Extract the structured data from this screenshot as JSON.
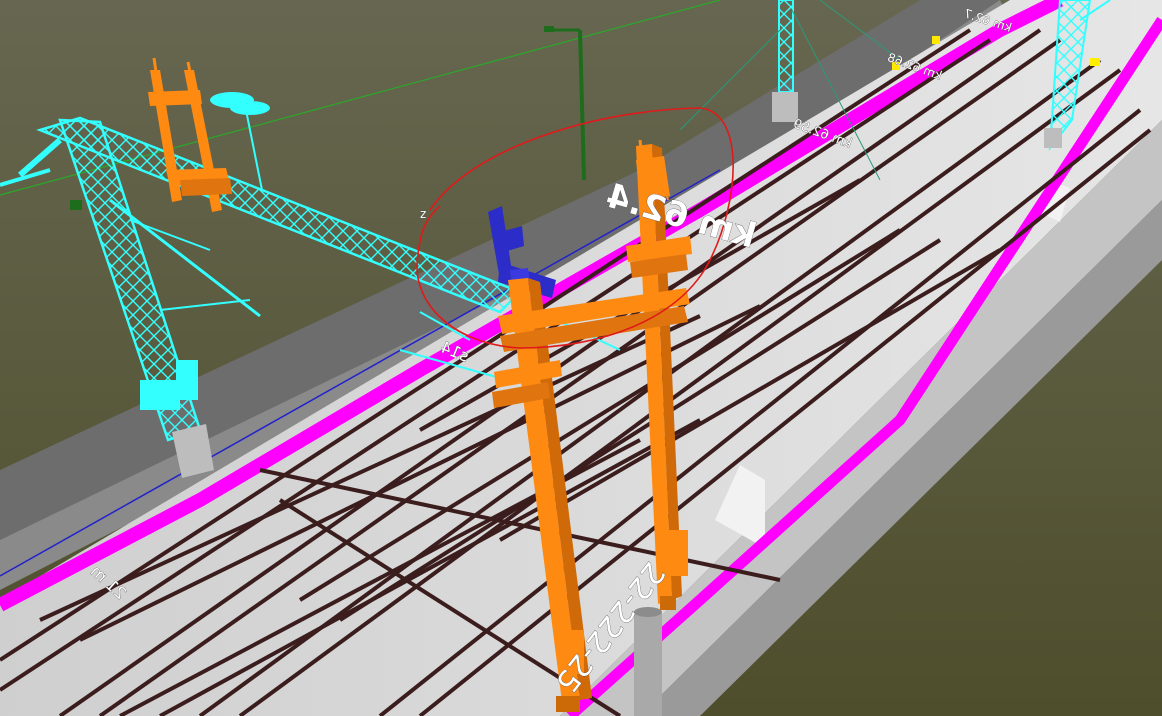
{
  "scene": {
    "colors": {
      "sky_top": "#676751",
      "ground": "#54542f",
      "deck_gray": "#6e6e6e",
      "deck_light": "#d8d8d8",
      "rail": "#3a1f1f",
      "magenta": "#ff00ff",
      "cyan": "#33ffff",
      "orange": "#ff8a12",
      "blue": "#2c2cc8",
      "annotation_red": "#e01a1a",
      "guide_green": "#22aa22",
      "pole_green": "#1d6d1d",
      "pier_gray": "#a8a8a8"
    },
    "labels": {
      "km_near": "km 62.4",
      "km_mid_1": "km 62.59",
      "km_mid_2": "km 62.68",
      "km_far": "km 62.7",
      "deck_code": "22-222-25",
      "deck_left_a": "s14",
      "deck_left_b": "21 m",
      "tag_right": "z"
    },
    "objects": {
      "selected_mast": "orange-portal-mast",
      "highlighted_bracket": "blue-cantilever",
      "annotation": "red-circle"
    }
  }
}
